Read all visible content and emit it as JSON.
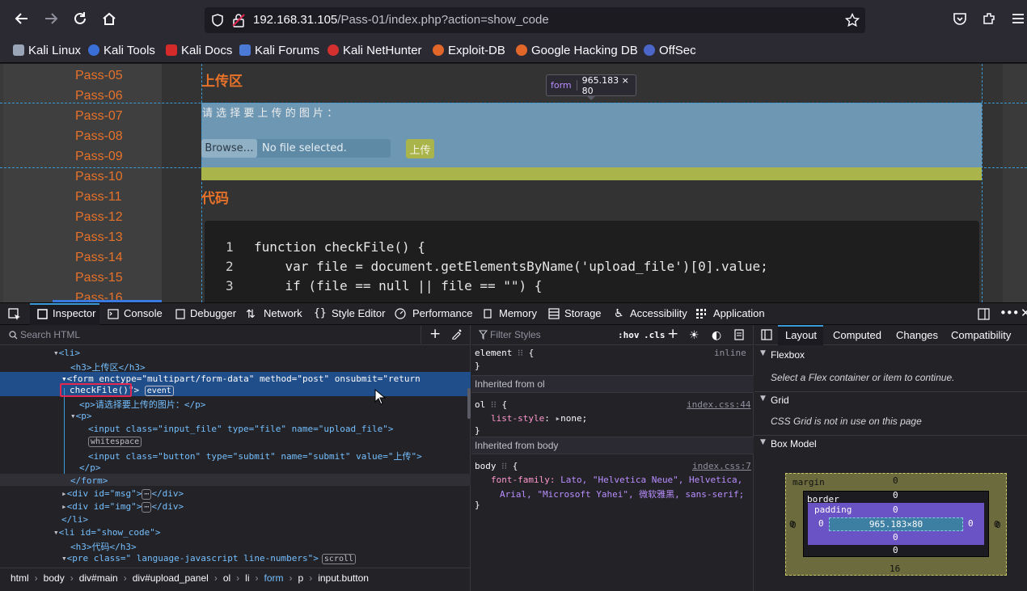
{
  "browser": {
    "url_host": "192.168.31.105",
    "url_path": "/Pass-01/index.php?action=show_code",
    "bookmarks": [
      "Kali Linux",
      "Kali Tools",
      "Kali Docs",
      "Kali Forums",
      "Kali NetHunter",
      "Exploit-DB",
      "Google Hacking DB",
      "OffSec"
    ]
  },
  "page": {
    "sidebar_items": [
      "Pass-05",
      "Pass-06",
      "Pass-07",
      "Pass-08",
      "Pass-09",
      "Pass-10",
      "Pass-11",
      "Pass-12",
      "Pass-13",
      "Pass-14",
      "Pass-15",
      "Pass-16"
    ],
    "upload_heading": "上传区",
    "form_tooltip_tag": "form",
    "form_tooltip_size": "965.183 × 80",
    "upload_prompt": "请 选 择 要 上 传 的 图 片 ：",
    "browse_label": "Browse…",
    "no_file_label": "No file selected.",
    "upload_button": "上传",
    "code_heading": "代码",
    "code_lines": [
      {
        "n": "1",
        "text": "function checkFile() {"
      },
      {
        "n": "2",
        "text": "    var file = document.getElementsByName('upload_file')[0].value;"
      },
      {
        "n": "3",
        "text": "    if (file == null || file == \"\") {"
      }
    ]
  },
  "devtools": {
    "tabs": [
      "Inspector",
      "Console",
      "Debugger",
      "Network",
      "Style Editor",
      "Performance",
      "Memory",
      "Storage",
      "Accessibility",
      "Application"
    ],
    "search_placeholder": "Search HTML",
    "filter_placeholder": "Filter Styles",
    "hov": ":hov",
    "cls": ".cls",
    "html_lines": [
      "<li>",
      "<h3>上传区</h3>",
      "<form enctype=\"multipart/form-data\" method=\"post\" onsubmit=\"return",
      "checkFile()\">",
      "<p>请选择要上传的图片：</p>",
      "<p>",
      "<input class=\"input_file\" type=\"file\" name=\"upload_file\">",
      "whitespace",
      "<input class=\"button\" type=\"submit\" name=\"submit\" value=\"上传\">",
      "</p>",
      "</form>",
      "<div id=\"msg\">",
      "<div id=\"img\">",
      "</li>",
      "<li id=\"show_code\">",
      "<h3>代码</h3>",
      "<pre class=\" language-javascript line-numbers\">"
    ],
    "badge_event": "event",
    "badge_scroll": "scroll",
    "breadcrumbs": [
      "html",
      "body",
      "div#main",
      "div#upload_panel",
      "ol",
      "li",
      "form",
      "p",
      "input.button"
    ],
    "rules": {
      "element_selector": "element",
      "element_source": "inline",
      "inherited_ol": "Inherited from ol",
      "ol_selector": "ol",
      "ol_source": "index.css:44",
      "ol_prop": "list-style",
      "ol_val": "none;",
      "inherited_body": "Inherited from body",
      "body_selector": "body",
      "body_source": "index.css:7",
      "body_prop": "font-family:",
      "body_val_1": "Lato, \"Helvetica Neue\", Helvetica,",
      "body_val_2": "Arial, \"Microsoft Yahei\", 微软雅黑, sans-serif;"
    },
    "layout_tabs": [
      "Layout",
      "Computed",
      "Changes",
      "Compatibility"
    ],
    "flexbox_title": "Flexbox",
    "flexbox_msg": "Select a Flex container or item to continue.",
    "grid_title": "Grid",
    "grid_msg": "CSS Grid is not in use on this page",
    "boxmodel_title": "Box Model",
    "boxmodel": {
      "margin_label": "margin",
      "border_label": "border",
      "padding_label": "padding",
      "content": "965.183×80",
      "zero": "0",
      "margin_bottom": "16"
    }
  }
}
